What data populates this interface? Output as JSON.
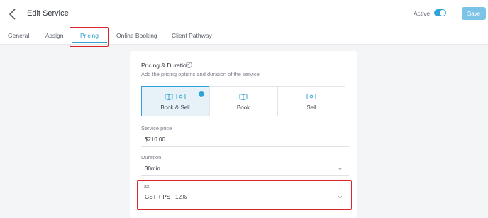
{
  "header": {
    "title": "Edit Service",
    "active_label": "Active",
    "active_on": true,
    "save_label": "Save"
  },
  "tabs": [
    {
      "label": "General"
    },
    {
      "label": "Assign"
    },
    {
      "label": "Pricing",
      "active": true
    },
    {
      "label": "Online Booking"
    },
    {
      "label": "Client Pathway"
    }
  ],
  "pricing": {
    "title": "Pricing & Duration",
    "subtitle": "Add the pricing options and duration of the service",
    "options": [
      {
        "label": "Book & Sell",
        "selected": true
      },
      {
        "label": "Book",
        "selected": false
      },
      {
        "label": "Sell",
        "selected": false
      }
    ]
  },
  "fields": {
    "service_price": {
      "label": "Service price",
      "value": "$210.00"
    },
    "duration": {
      "label": "Duration",
      "value": "30min"
    },
    "tax": {
      "label": "Tax",
      "value": "GST + PST 12%"
    }
  },
  "colors": {
    "accent": "#2fa3d5",
    "highlight": "#d7262b"
  }
}
